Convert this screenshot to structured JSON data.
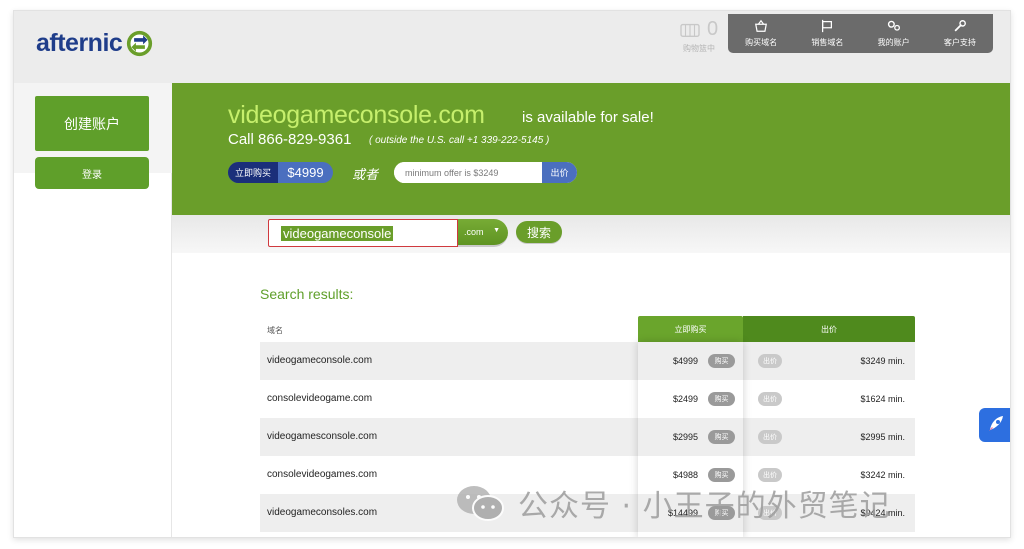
{
  "header": {
    "logo_text": "afternic",
    "cart_count": "0",
    "cart_label": "购物篮中",
    "nav": [
      {
        "label": "购买域名",
        "icon": "basket-icon"
      },
      {
        "label": "销售域名",
        "icon": "sign-icon"
      },
      {
        "label": "我的账户",
        "icon": "gears-icon"
      },
      {
        "label": "客户支持",
        "icon": "wrench-icon"
      }
    ]
  },
  "sidebar": {
    "create_account_label": "创建账户",
    "login_label": "登录"
  },
  "banner": {
    "domain": "videogameconsole.com",
    "available_text": "is available for sale!",
    "call_text": "Call 866-829-9361",
    "outside_text": "( outside the U.S. call +1 339-222-5145 )",
    "buy_now_label": "立即购买",
    "buy_now_price": "$4999",
    "or_text": "或者",
    "offer_placeholder": "minimum offer is $3249",
    "offer_button_label": "出价"
  },
  "search": {
    "value": "videogameconsole",
    "tld": ".com",
    "button_label": "搜索"
  },
  "results": {
    "title": "Search results:",
    "columns": {
      "domain": "域名",
      "buy_now": "立即购买",
      "offer": "出价"
    },
    "buy_label": "购买",
    "offer_label": "出价",
    "rows": [
      {
        "domain": "videogameconsole.com",
        "price": "$4999",
        "min": "$3249 min."
      },
      {
        "domain": "consolevideogame.com",
        "price": "$2499",
        "min": "$1624 min."
      },
      {
        "domain": "videogamesconsole.com",
        "price": "$2995",
        "min": "$2995 min."
      },
      {
        "domain": "consolevideogames.com",
        "price": "$4988",
        "min": "$3242 min."
      },
      {
        "domain": "videogameconsoles.com",
        "price": "$14499",
        "min": "$9424 min."
      }
    ]
  },
  "watermark": {
    "text": "公众号 · 小王子的外贸笔记"
  },
  "colors": {
    "brand_green": "#6a9e2a",
    "domain_highlight": "#c6ef6c",
    "buy_pill_blue": "#1b2f7a",
    "logo_blue": "#1f3d8a"
  }
}
